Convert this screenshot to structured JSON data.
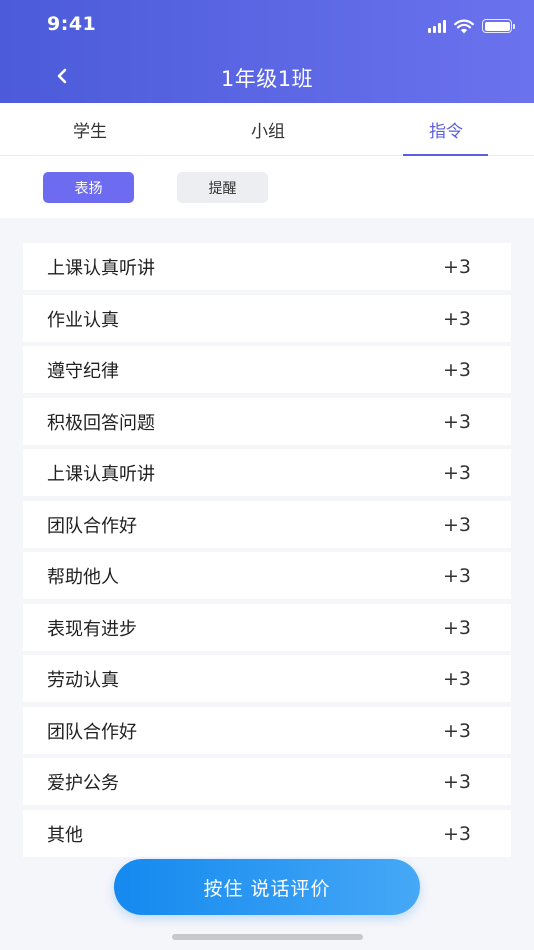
{
  "status_bar": {
    "time": "9:41"
  },
  "header": {
    "title": "1年级1班"
  },
  "tabs": [
    {
      "label": "学生",
      "active": false
    },
    {
      "label": "小组",
      "active": false
    },
    {
      "label": "指令",
      "active": true
    }
  ],
  "filters": [
    {
      "label": "表扬",
      "active": true
    },
    {
      "label": "提醒",
      "active": false
    }
  ],
  "items": [
    {
      "label": "上课认真听讲",
      "score": "+3"
    },
    {
      "label": "作业认真",
      "score": "+3"
    },
    {
      "label": "遵守纪律",
      "score": "+3"
    },
    {
      "label": "积极回答问题",
      "score": "+3"
    },
    {
      "label": "上课认真听讲",
      "score": "+3"
    },
    {
      "label": "团队合作好",
      "score": "+3"
    },
    {
      "label": "帮助他人",
      "score": "+3"
    },
    {
      "label": "表现有进步",
      "score": "+3"
    },
    {
      "label": "劳动认真",
      "score": "+3"
    },
    {
      "label": "团队合作好",
      "score": "+3"
    },
    {
      "label": "爱护公务",
      "score": "+3"
    },
    {
      "label": "其他",
      "score": "+3"
    }
  ],
  "talk_button": {
    "label": "按住 说话评价"
  },
  "colors": {
    "header_start": "#4b5bd9",
    "header_end": "#6b72ee",
    "accent": "#5b5fe0",
    "chip_active": "#6d6cf0",
    "talk_start": "#1489ef",
    "talk_end": "#46a8f6"
  },
  "icons": {
    "back": "chevron-left-icon",
    "signal": "cellular-signal-icon",
    "wifi": "wifi-icon",
    "battery": "battery-icon"
  }
}
